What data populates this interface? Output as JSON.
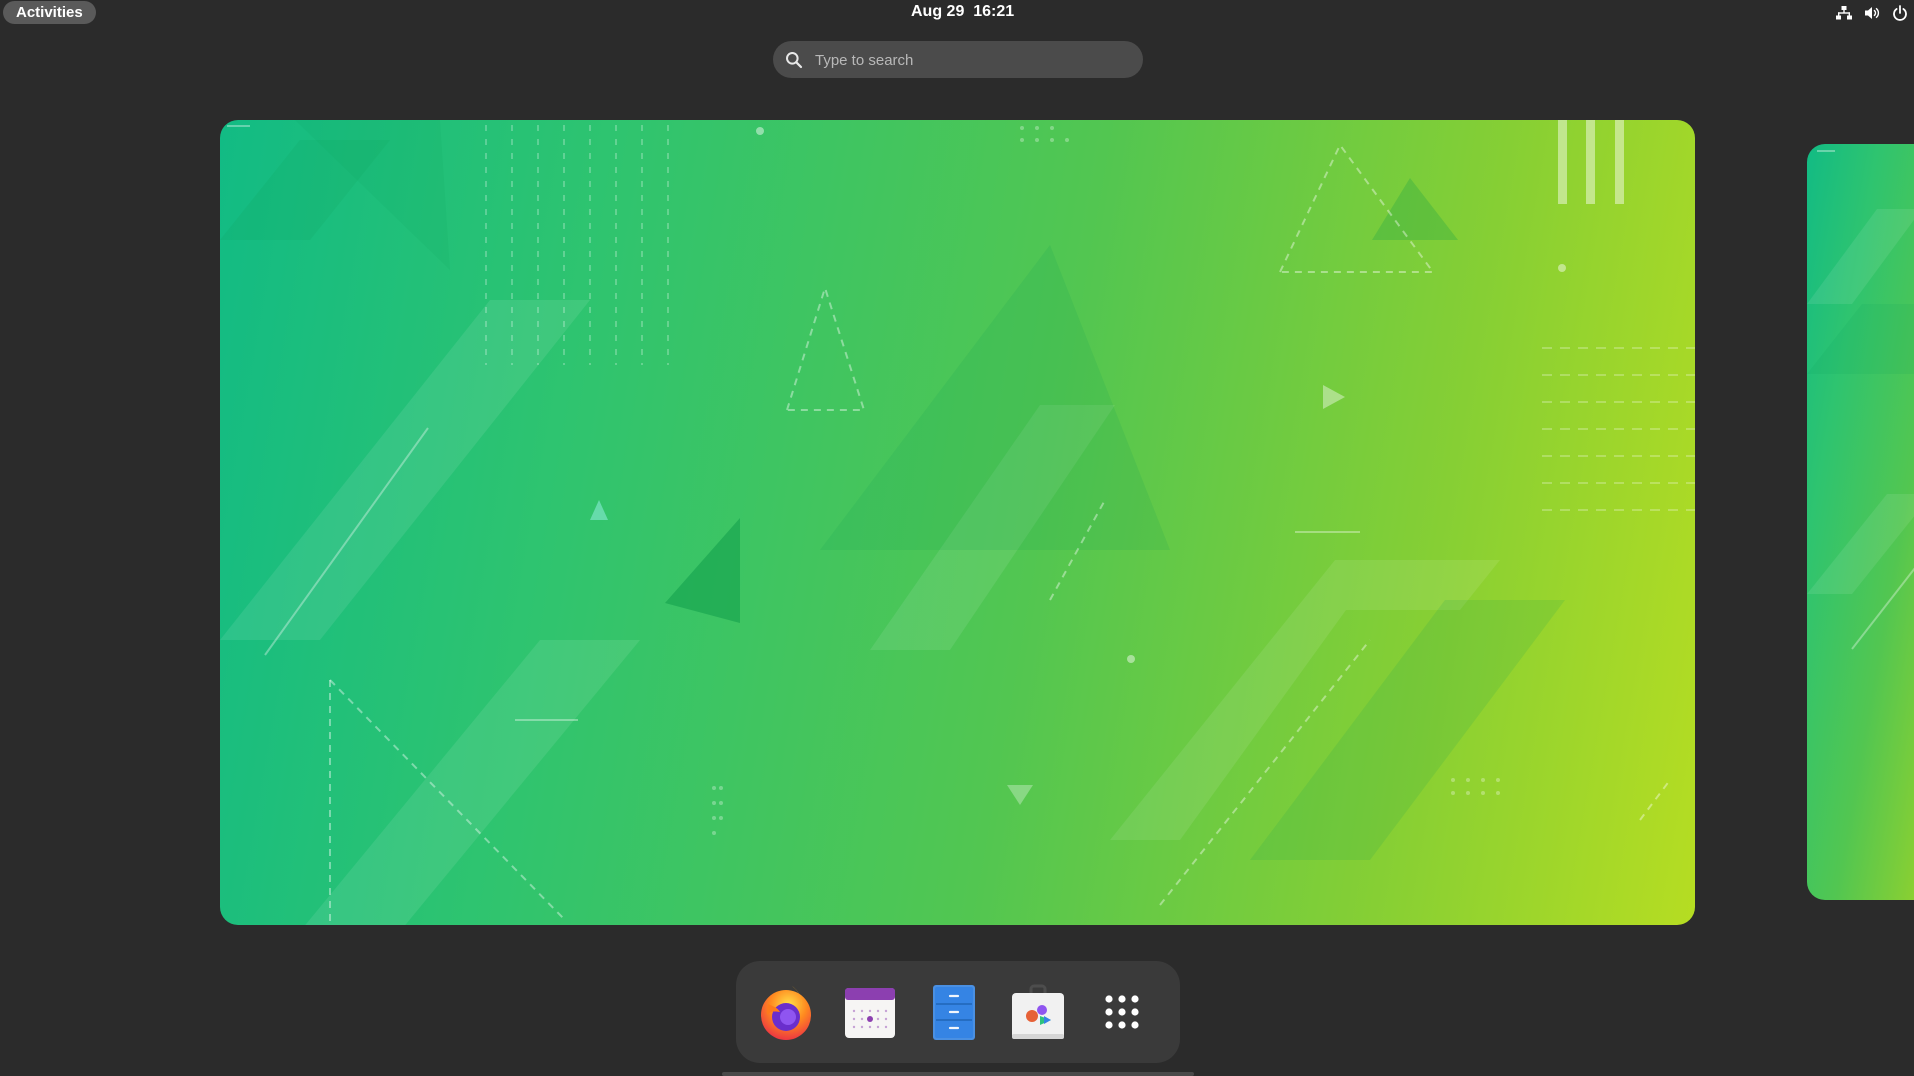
{
  "topbar": {
    "activities_label": "Activities",
    "clock": "Aug 29  16:21",
    "status_icons": [
      "network-wired-icon",
      "volume-icon",
      "power-icon"
    ]
  },
  "search": {
    "placeholder": "Type to search"
  },
  "workspaces": {
    "items": [
      "workspace-1",
      "workspace-2"
    ],
    "active": 0
  },
  "dash": {
    "apps": [
      "Firefox",
      "Calendar",
      "Files",
      "Software",
      "Show Applications"
    ]
  },
  "colors": {
    "panel_bg": "#2b2b2b",
    "dash_bg": "#3a3a3a",
    "wallpaper_start": "#12bb84",
    "wallpaper_end": "#b6dd22"
  }
}
